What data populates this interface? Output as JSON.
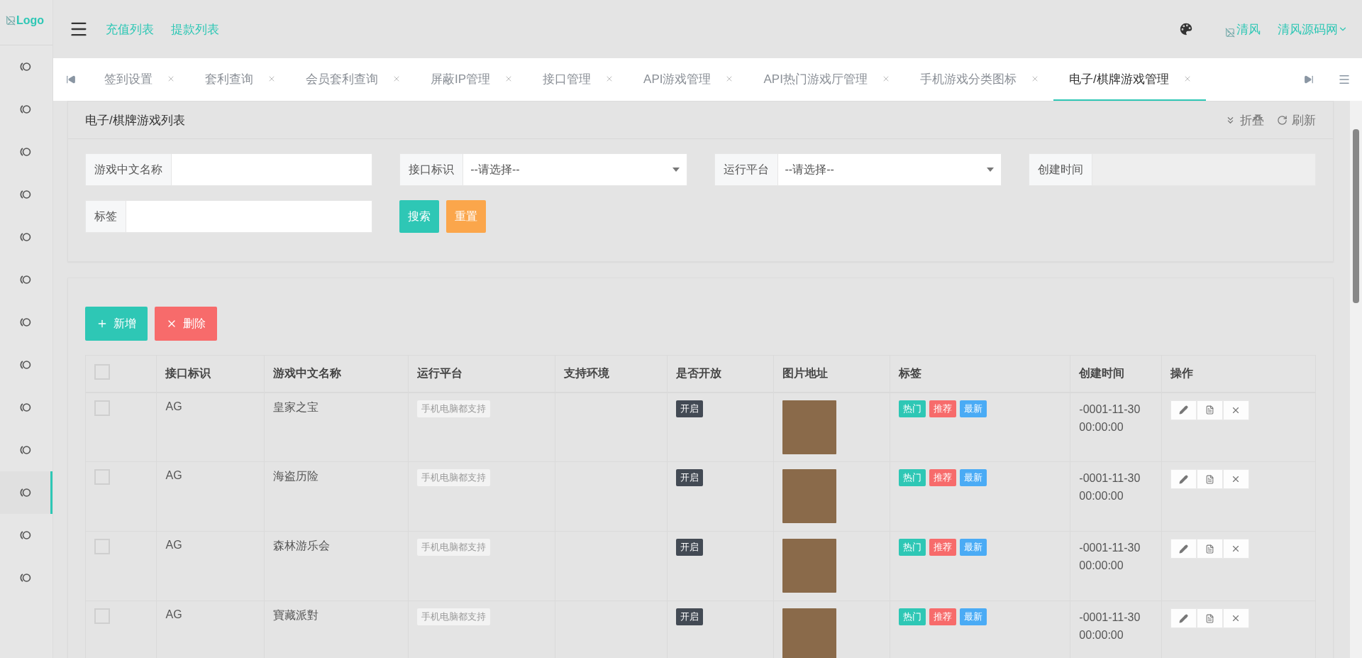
{
  "logo": {
    "alt": "Logo"
  },
  "header": {
    "links": [
      "充值列表",
      "提款列表"
    ],
    "user_image_alt": "清风",
    "user_name": "清风源码网"
  },
  "sidebar": {
    "items": [
      {
        "selected": false
      },
      {
        "selected": false
      },
      {
        "selected": false
      },
      {
        "selected": false
      },
      {
        "selected": false
      },
      {
        "selected": false
      },
      {
        "selected": false
      },
      {
        "selected": false
      },
      {
        "selected": false
      },
      {
        "selected": false
      },
      {
        "selected": true
      },
      {
        "selected": false
      },
      {
        "selected": false
      }
    ]
  },
  "tabs": [
    {
      "label": "签到设置",
      "selected": false
    },
    {
      "label": "套利查询",
      "selected": false
    },
    {
      "label": "会员套利查询",
      "selected": false
    },
    {
      "label": "屏蔽IP管理",
      "selected": false
    },
    {
      "label": "接口管理",
      "selected": false
    },
    {
      "label": "API游戏管理",
      "selected": false
    },
    {
      "label": "API热门游戏厅管理",
      "selected": false
    },
    {
      "label": "手机游戏分类图标",
      "selected": false
    },
    {
      "label": "电子/棋牌游戏管理",
      "selected": true
    }
  ],
  "panel": {
    "title": "电子/棋牌游戏列表",
    "collapse": "折叠",
    "refresh": "刷新"
  },
  "filters": [
    {
      "kind": "text",
      "label": "游戏中文名称"
    },
    {
      "kind": "select",
      "label": "接口标识",
      "value": "--请选择--"
    },
    {
      "kind": "select",
      "label": "运行平台",
      "value": "--请选择--"
    },
    {
      "kind": "date",
      "label": "创建时间"
    },
    {
      "kind": "text",
      "label": "标签"
    },
    {
      "kind": "buttons",
      "search": "搜索",
      "reset": "重置"
    }
  ],
  "toolbar": {
    "add": "新增",
    "delete": "删除"
  },
  "table": {
    "select_all_checked": false,
    "columns": [
      "接口标识",
      "游戏中文名称",
      "运行平台",
      "支持环境",
      "是否开放",
      "图片地址",
      "标签",
      "创建时间",
      "操作"
    ],
    "rows": [
      {
        "checked": false,
        "interface": "AG",
        "name": "皇家之宝",
        "platform": "手机电脑都支持",
        "status": "开启",
        "tags": [
          {
            "label": "热门",
            "color": "#2ec7b5"
          },
          {
            "label": "推荐",
            "color": "#f76b6b"
          },
          {
            "label": "最新",
            "color": "#4aabf5"
          }
        ],
        "created": "-0001-11-30 00:00:00"
      },
      {
        "checked": false,
        "interface": "AG",
        "name": "海盗历险",
        "platform": "手机电脑都支持",
        "status": "开启",
        "tags": [
          {
            "label": "热门",
            "color": "#2ec7b5"
          },
          {
            "label": "推荐",
            "color": "#f76b6b"
          },
          {
            "label": "最新",
            "color": "#4aabf5"
          }
        ],
        "created": "-0001-11-30 00:00:00"
      },
      {
        "checked": false,
        "interface": "AG",
        "name": "森林游乐会",
        "platform": "手机电脑都支持",
        "status": "开启",
        "tags": [
          {
            "label": "热门",
            "color": "#2ec7b5"
          },
          {
            "label": "推荐",
            "color": "#f76b6b"
          },
          {
            "label": "最新",
            "color": "#4aabf5"
          }
        ],
        "created": "-0001-11-30 00:00:00"
      },
      {
        "checked": false,
        "interface": "AG",
        "name": "寶藏派對",
        "platform": "手机电脑都支持",
        "status": "开启",
        "tags": [
          {
            "label": "热门",
            "color": "#2ec7b5"
          },
          {
            "label": "推荐",
            "color": "#f76b6b"
          },
          {
            "label": "最新",
            "color": "#4aabf5"
          }
        ],
        "created": "-0001-11-30 00:00:00"
      }
    ]
  }
}
